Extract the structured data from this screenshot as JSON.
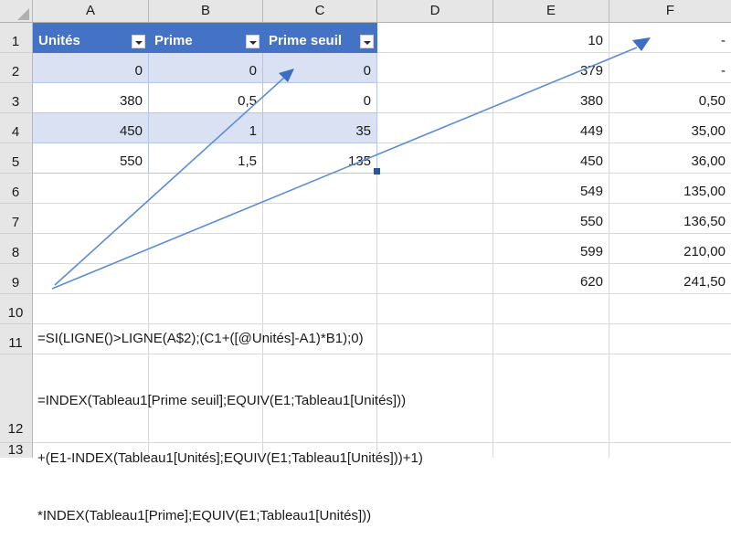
{
  "app": {
    "kind": "spreadsheet",
    "locale_decimal_separator": ",",
    "colors": {
      "table_header_fill": "#4472C4",
      "table_header_text": "#FFFFFF",
      "table_band_fill": "#D9E1F2",
      "table_border": "#B4C6E7",
      "grid_line": "#D8D8D8",
      "header_strip": "#E6E6E6",
      "arrow": "#5B8DD9",
      "fill_handle": "#2A5699"
    }
  },
  "grid": {
    "column_headers": [
      "A",
      "B",
      "C",
      "D",
      "E",
      "F"
    ],
    "row_headers": [
      "1",
      "2",
      "3",
      "4",
      "5",
      "6",
      "7",
      "8",
      "9",
      "10",
      "11",
      "12",
      "13"
    ],
    "select_all_icon": "select-all-triangle-icon"
  },
  "table": {
    "name": "Tableau1",
    "range": "A1:C5",
    "headers": [
      "Unités",
      "Prime",
      "Prime seuil"
    ],
    "filter_icon": "filter-dropdown-icon",
    "rows": [
      {
        "unites": "0",
        "prime": "0",
        "prime_seuil": "0"
      },
      {
        "unites": "380",
        "prime": "0,5",
        "prime_seuil": "0"
      },
      {
        "unites": "450",
        "prime": "1",
        "prime_seuil": "35"
      },
      {
        "unites": "550",
        "prime": "1,5",
        "prime_seuil": "135"
      }
    ]
  },
  "lookup": {
    "column_e_label": "E",
    "column_f_label": "F",
    "rows": [
      {
        "e": "10",
        "f": "-"
      },
      {
        "e": "379",
        "f": "-"
      },
      {
        "e": "380",
        "f": "0,50"
      },
      {
        "e": "449",
        "f": "35,00"
      },
      {
        "e": "450",
        "f": "36,00"
      },
      {
        "e": "549",
        "f": "135,00"
      },
      {
        "e": "550",
        "f": "136,50"
      },
      {
        "e": "599",
        "f": "210,00"
      },
      {
        "e": "620",
        "f": "241,50"
      }
    ]
  },
  "formulas": {
    "row10": {
      "row_label": "10",
      "text": "=SI(LIGNE()>LIGNE(A$2);(C1+([@Unités]-A1)*B1);0)"
    },
    "row12": {
      "row_label": "12",
      "lines": [
        "=INDEX(Tableau1[Prime seuil];EQUIV(E1;Tableau1[Unités]))",
        "+(E1-INDEX(Tableau1[Unités];EQUIV(E1;Tableau1[Unités]))+1)",
        "*INDEX(Tableau1[Prime];EQUIV(E1;Tableau1[Unités]))"
      ]
    }
  },
  "annotations": {
    "arrows": [
      {
        "name": "arrow-to-prime-seuil-column",
        "from": "formula-row10",
        "to": "cell-C2"
      },
      {
        "name": "arrow-to-column-f",
        "from": "formula-row12",
        "to": "cell-F1"
      }
    ]
  }
}
